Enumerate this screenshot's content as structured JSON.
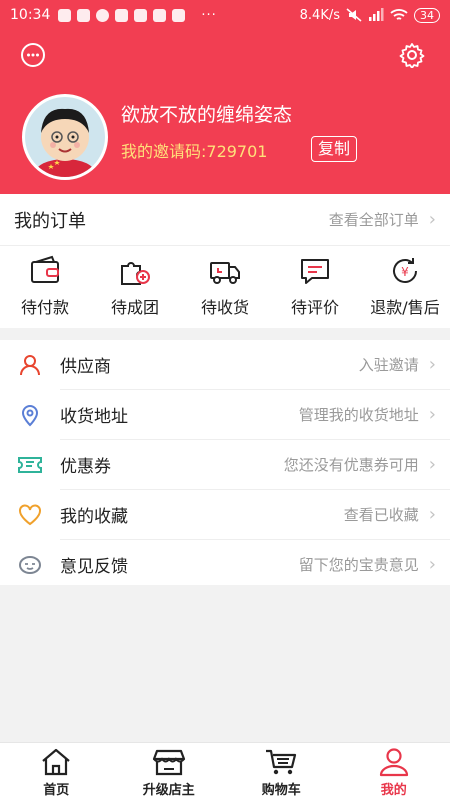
{
  "status_bar": {
    "time": "10:34",
    "network_speed": "8.4K/s",
    "battery": "34",
    "more": "···"
  },
  "colors": {
    "brand": "#f23e52",
    "invite_text": "#ffe07a",
    "active_tab": "#e8364a"
  },
  "header": {
    "message_icon": "chat-bubble-icon",
    "settings_icon": "gear-icon",
    "nickname": "欲放不放的缠绵姿态",
    "invite_code": "我的邀请码:729701",
    "copy_label": "复制"
  },
  "orders": {
    "title": "我的订单",
    "view_all": "查看全部订单",
    "items": [
      {
        "label": "待付款",
        "icon": "wallet-icon"
      },
      {
        "label": "待成团",
        "icon": "group-puzzle-icon"
      },
      {
        "label": "待收货",
        "icon": "truck-icon"
      },
      {
        "label": "待评价",
        "icon": "comment-icon"
      },
      {
        "label": "退款/售后",
        "icon": "refund-icon"
      }
    ]
  },
  "menu": [
    {
      "title": "供应商",
      "hint": "入驻邀请",
      "icon": "user-icon"
    },
    {
      "title": "收货地址",
      "hint": "管理我的收货地址",
      "icon": "location-icon"
    },
    {
      "title": "优惠券",
      "hint": "您还没有优惠券可用",
      "icon": "ticket-icon"
    },
    {
      "title": "我的收藏",
      "hint": "查看已收藏",
      "icon": "heart-icon"
    },
    {
      "title": "意见反馈",
      "hint": "留下您的宝贵意见",
      "icon": "feedback-icon"
    }
  ],
  "tabs": [
    {
      "label": "首页",
      "icon": "home-icon"
    },
    {
      "label": "升级店主",
      "icon": "store-icon"
    },
    {
      "label": "购物车",
      "icon": "cart-icon"
    },
    {
      "label": "我的",
      "icon": "profile-icon"
    }
  ]
}
